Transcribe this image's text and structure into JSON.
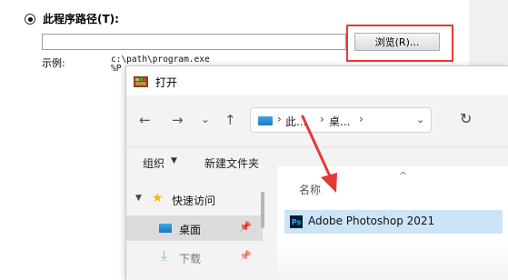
{
  "properties_dialog": {
    "program_path_label": "此程序路径(T):",
    "path_value": "",
    "browse_label": "浏览(R)...",
    "example_label": "示例:",
    "example_value": "c:\\path\\program.exe\n%P"
  },
  "open_dialog": {
    "title": "打开",
    "nav": {
      "back": "←",
      "forward": "→",
      "recent": "⌄",
      "up": "↑"
    },
    "address": {
      "crumb1": "此...",
      "crumb2": "桌...",
      "dropdown": "⌄"
    },
    "refresh": "↻",
    "toolbar": {
      "organize": "组织",
      "new_folder": "新建文件夹"
    },
    "navigation": {
      "quick_access": "快速访问",
      "desktop": "桌面",
      "downloads": "下载"
    },
    "file_list": {
      "column_name": "名称",
      "files": [
        {
          "name": "Adobe Photoshop 2021",
          "icon": "Ps"
        }
      ]
    }
  },
  "annotations": {
    "highlight_color": "#e53935"
  }
}
